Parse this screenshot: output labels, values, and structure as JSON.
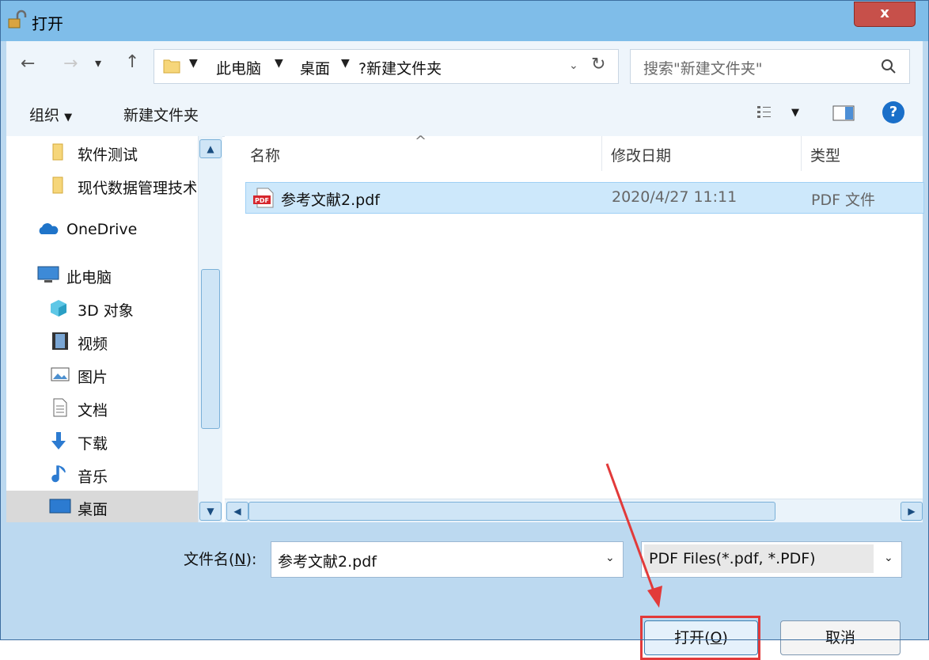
{
  "window": {
    "title": "打开",
    "close_label": "x"
  },
  "nav": {
    "back": "←",
    "forward": "→",
    "recent": "▾",
    "up": "↑",
    "breadcrumbs": [
      "此电脑",
      "桌面",
      "?新建文件夹"
    ],
    "refresh": "↻",
    "search_placeholder": "搜索\"新建文件夹\""
  },
  "toolbar": {
    "organize": "组织",
    "new_folder": "新建文件夹",
    "help": "?"
  },
  "sidebar": {
    "items": [
      {
        "label": "软件测试",
        "icon": "folder-icon"
      },
      {
        "label": "现代数据管理技术",
        "icon": "folder-icon"
      },
      {
        "label": "OneDrive",
        "icon": "cloud-icon"
      },
      {
        "label": "此电脑",
        "icon": "computer-icon"
      },
      {
        "label": "3D 对象",
        "icon": "cube-icon"
      },
      {
        "label": "视频",
        "icon": "video-icon"
      },
      {
        "label": "图片",
        "icon": "picture-icon"
      },
      {
        "label": "文档",
        "icon": "document-icon"
      },
      {
        "label": "下载",
        "icon": "download-icon"
      },
      {
        "label": "音乐",
        "icon": "music-icon"
      },
      {
        "label": "桌面",
        "icon": "desktop-icon",
        "selected": true
      }
    ]
  },
  "files": {
    "columns": [
      "名称",
      "修改日期",
      "类型"
    ],
    "rows": [
      {
        "name": "参考文献2.pdf",
        "modified": "2020/4/27 11:11",
        "type": "PDF 文件",
        "icon_text": "PDF"
      }
    ]
  },
  "bottom": {
    "filename_label_pre": "文件名(",
    "filename_label_key": "N",
    "filename_label_post": "):",
    "filename_value": "参考文献2.pdf",
    "filetype_value": "PDF Files(*.pdf, *.PDF)",
    "open_pre": "打开(",
    "open_key": "O",
    "open_post": ")",
    "cancel": "取消"
  },
  "colors": {
    "highlight": "#e23a3a",
    "selection": "#cde8fb",
    "accent": "#1a6fc9"
  }
}
